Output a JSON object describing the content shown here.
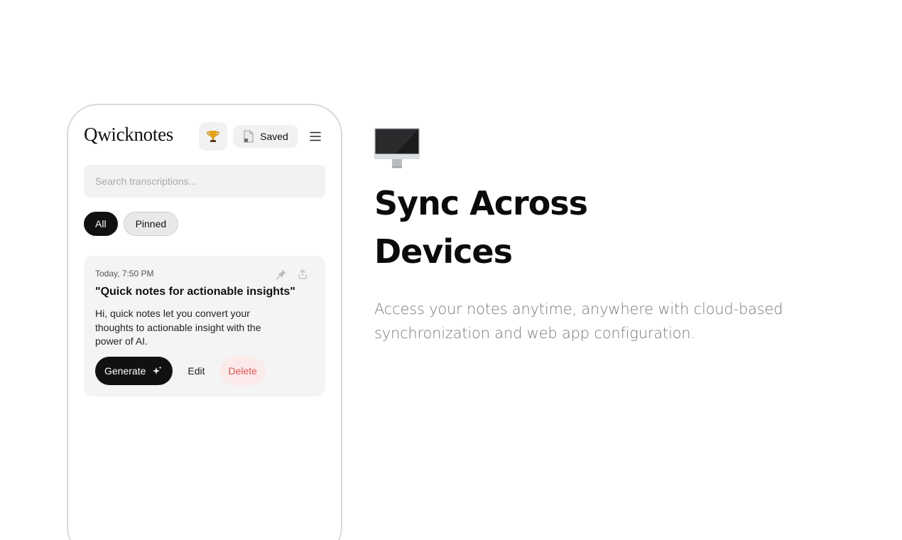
{
  "app": {
    "logo": "Qwicknotes",
    "saved_label": "Saved",
    "search_placeholder": "Search transcriptions...",
    "filters": [
      {
        "label": "All",
        "active": true
      },
      {
        "label": "Pinned",
        "active": false
      }
    ],
    "notes": [
      {
        "time": "Today, 7:50 PM",
        "title": "\"Quick notes for actionable insights\"",
        "body": "Hi, quick notes let you convert your thoughts to actionable insight with the power of AI.",
        "generate_label": "Generate",
        "edit_label": "Edit",
        "delete_label": "Delete"
      }
    ]
  },
  "feature": {
    "title_line1": "Sync Across",
    "title_line2": "Devices",
    "description": "Access your notes anytime, anywhere with cloud-based synchronization and web app configuration."
  },
  "icons": {
    "trophy": "trophy-icon",
    "document": "document-icon",
    "menu": "hamburger-menu-icon",
    "pin": "pin-icon",
    "share": "share-icon",
    "sparkle": "sparkle-icon",
    "monitor": "monitor-icon"
  },
  "colors": {
    "primary": "#111111",
    "delete_text": "#e05555",
    "delete_bg": "#fbeaea",
    "description_text": "#7a7a7a"
  }
}
